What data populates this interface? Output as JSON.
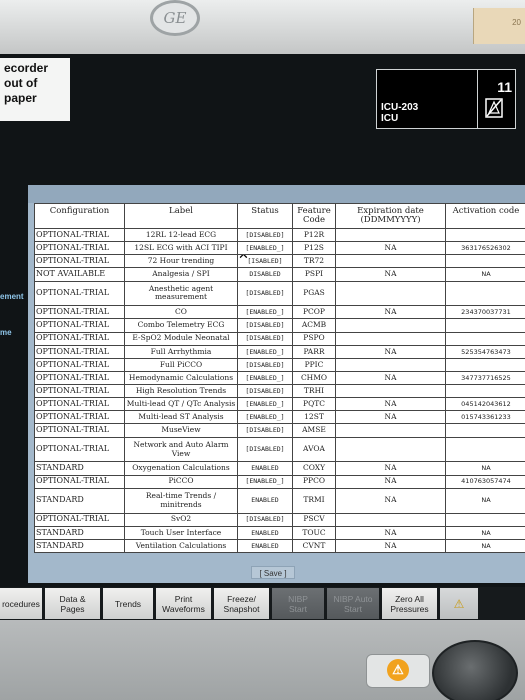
{
  "device": {
    "logo_text": "GE",
    "corner_tag": "20"
  },
  "alarm": {
    "lines": [
      "ecorder",
      "out of",
      "paper"
    ]
  },
  "unit": {
    "bed": "ICU-203",
    "location": "ICU",
    "number": "11",
    "icon": "alarm-silenced-icon"
  },
  "side_labels": {
    "label1": "ement",
    "label2": "me"
  },
  "table": {
    "headers": [
      "Configuration",
      "Label",
      "Status",
      "Feature Code",
      "Expiration date (DDMMYYYY)",
      "Activation code"
    ],
    "rows": [
      [
        "OPTIONAL-TRIAL",
        "12RL 12-lead ECG",
        "[DISABLED]",
        "P12R",
        "",
        ""
      ],
      [
        "OPTIONAL-TRIAL",
        "12SL ECG with ACI TIPI",
        "[ENABLED_]",
        "P12S",
        "NA",
        "363176526302"
      ],
      [
        "OPTIONAL-TRIAL",
        "72 Hour trending",
        "[ISABLED]",
        "TR72",
        "",
        ""
      ],
      [
        "NOT AVAILABLE",
        "Analgesia / SPI",
        "DISABLED",
        "PSPI",
        "NA",
        "NA"
      ],
      [
        "OPTIONAL-TRIAL",
        "Anesthetic agent measurement",
        "[DISABLED]",
        "PGAS",
        "",
        ""
      ],
      [
        "OPTIONAL-TRIAL",
        "CO",
        "[ENABLED_]",
        "PCOP",
        "NA",
        "234370037731"
      ],
      [
        "OPTIONAL-TRIAL",
        "Combo Telemetry ECG",
        "[DISABLED]",
        "ACMB",
        "",
        ""
      ],
      [
        "OPTIONAL-TRIAL",
        "E-SpO2 Module Neonatal",
        "[DISABLED]",
        "PSPO",
        "",
        ""
      ],
      [
        "OPTIONAL-TRIAL",
        "Full Arrhythmia",
        "[ENABLED_]",
        "PARR",
        "NA",
        "525354763473"
      ],
      [
        "OPTIONAL-TRIAL",
        "Full PiCCO",
        "[DISABLED]",
        "PPIC",
        "",
        ""
      ],
      [
        "OPTIONAL-TRIAL",
        "Hemodynamic Calculations",
        "[ENABLED_]",
        "CHMO",
        "NA",
        "347737716525"
      ],
      [
        "OPTIONAL-TRIAL",
        "High Resolution Trends",
        "[DISABLED]",
        "TRHI",
        "",
        ""
      ],
      [
        "OPTIONAL-TRIAL",
        "Multi-lead QT / QTc Analysis",
        "[ENABLED_]",
        "PQTC",
        "NA",
        "045142043612"
      ],
      [
        "OPTIONAL-TRIAL",
        "Multi-lead ST Analysis",
        "[ENABLED_]",
        "12ST",
        "NA",
        "015743361233"
      ],
      [
        "OPTIONAL-TRIAL",
        "MuseView",
        "[DISABLED]",
        "AMSE",
        "",
        ""
      ],
      [
        "OPTIONAL-TRIAL",
        "Network and Auto Alarm View",
        "[DISABLED]",
        "AVOA",
        "",
        ""
      ],
      [
        "STANDARD",
        "Oxygenation Calculations",
        "ENABLED",
        "COXY",
        "NA",
        "NA"
      ],
      [
        "OPTIONAL-TRIAL",
        "PiCCO",
        "[ENABLED_]",
        "PPCO",
        "NA",
        "410763057474"
      ],
      [
        "STANDARD",
        "Real-time Trends / minitrends",
        "ENABLED",
        "TRMI",
        "NA",
        "NA"
      ],
      [
        "OPTIONAL-TRIAL",
        "SvO2",
        "[DISABLED]",
        "PSCV",
        "",
        ""
      ],
      [
        "STANDARD",
        "Touch User Interface",
        "ENABLED",
        "TOUC",
        "NA",
        "NA"
      ],
      [
        "STANDARD",
        "Ventilation Calculations",
        "ENABLED",
        "CVNT",
        "NA",
        "NA"
      ]
    ],
    "save_label": "[ Save ]"
  },
  "toolbar": {
    "buttons": [
      {
        "label": "rocedures",
        "enabled": true
      },
      {
        "label": "Data &\nPages",
        "enabled": true
      },
      {
        "label": "Trends",
        "enabled": true
      },
      {
        "label": "Print\nWaveforms",
        "enabled": true
      },
      {
        "label": "Freeze/\nSnapshot",
        "enabled": true
      },
      {
        "label": "NIBP\nStart",
        "enabled": false
      },
      {
        "label": "NIBP Auto\nStart",
        "enabled": false
      },
      {
        "label": "Zero All\nPressures",
        "enabled": true
      },
      {
        "label": "⚠",
        "enabled": true
      }
    ]
  },
  "colors": {
    "screen_bg": "#101416",
    "dialog_bg": "#a3b8cb",
    "side_label": "#8fc6ea",
    "alarm_orange": "#f1a21e"
  }
}
